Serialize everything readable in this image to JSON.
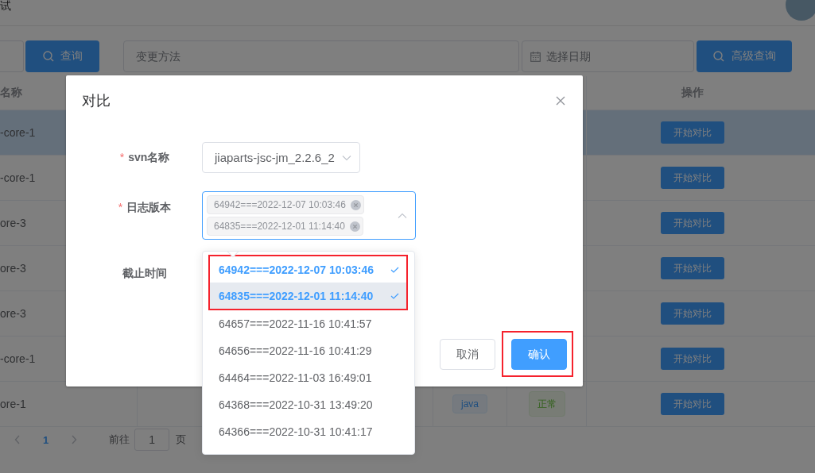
{
  "header": {
    "title": "试"
  },
  "filters": {
    "query_button": "查询",
    "method_field": {
      "placeholder": "变更方法"
    },
    "date_field": {
      "placeholder": "选择日期"
    },
    "advanced_button": "高级查询"
  },
  "table": {
    "columns": [
      "名称",
      "操作"
    ],
    "rows": [
      {
        "column_1": "-core-1",
        "hover": true,
        "action": "开始对比"
      },
      {
        "column_1": "-core-1",
        "hover": false,
        "action": "开始对比"
      },
      {
        "column_1": "ore-3",
        "hover": false,
        "action": "开始对比"
      },
      {
        "column_1": "ore-3",
        "hover": false,
        "action": "开始对比"
      },
      {
        "column_1": "ore-3",
        "hover": false,
        "action": "开始对比"
      },
      {
        "column_1": "-core-1",
        "hover": false,
        "action": "开始对比"
      },
      {
        "column_1": "ore-1",
        "hover": false,
        "type_tag": "java",
        "status_tag": "正常",
        "action": "开始对比"
      }
    ]
  },
  "pagination": {
    "pages": [
      {
        "label": "1",
        "selected": true
      }
    ],
    "goto_label": "前往",
    "page_input": "1",
    "page_unit": "页"
  },
  "dialog": {
    "title": "对比",
    "fields": [
      {
        "kind": "select",
        "label": "svn名称",
        "required_mark": "*",
        "value": "jiaparts-jsc-jm_2.2.6_2"
      },
      {
        "kind": "multiselect",
        "label": "日志版本",
        "required_mark": "*",
        "tags": [
          "64942===2022-12-07 10:03:46",
          "64835===2022-12-01 11:14:40"
        ]
      },
      {
        "kind": "label",
        "label": "截止时间"
      }
    ],
    "buttons": [
      {
        "label": "取消",
        "kind": "default",
        "highlighted": false
      },
      {
        "label": "确认",
        "kind": "primary",
        "highlighted": true
      }
    ]
  },
  "dropdown": {
    "options": [
      {
        "label": "64942===2022-12-07 10:03:46",
        "selected": true,
        "hover": false,
        "highlighted": true
      },
      {
        "label": "64835===2022-12-01 11:14:40",
        "selected": true,
        "hover": true,
        "highlighted": true
      },
      {
        "label": "64657===2022-11-16 10:41:57",
        "selected": false,
        "hover": false,
        "highlighted": false
      },
      {
        "label": "64656===2022-11-16 10:41:29",
        "selected": false,
        "hover": false,
        "highlighted": false
      },
      {
        "label": "64464===2022-11-03 16:49:01",
        "selected": false,
        "hover": false,
        "highlighted": false
      },
      {
        "label": "64368===2022-10-31 13:49:20",
        "selected": false,
        "hover": false,
        "highlighted": false
      },
      {
        "label": "64366===2022-10-31 10:41:17",
        "selected": false,
        "hover": false,
        "highlighted": false
      }
    ]
  }
}
